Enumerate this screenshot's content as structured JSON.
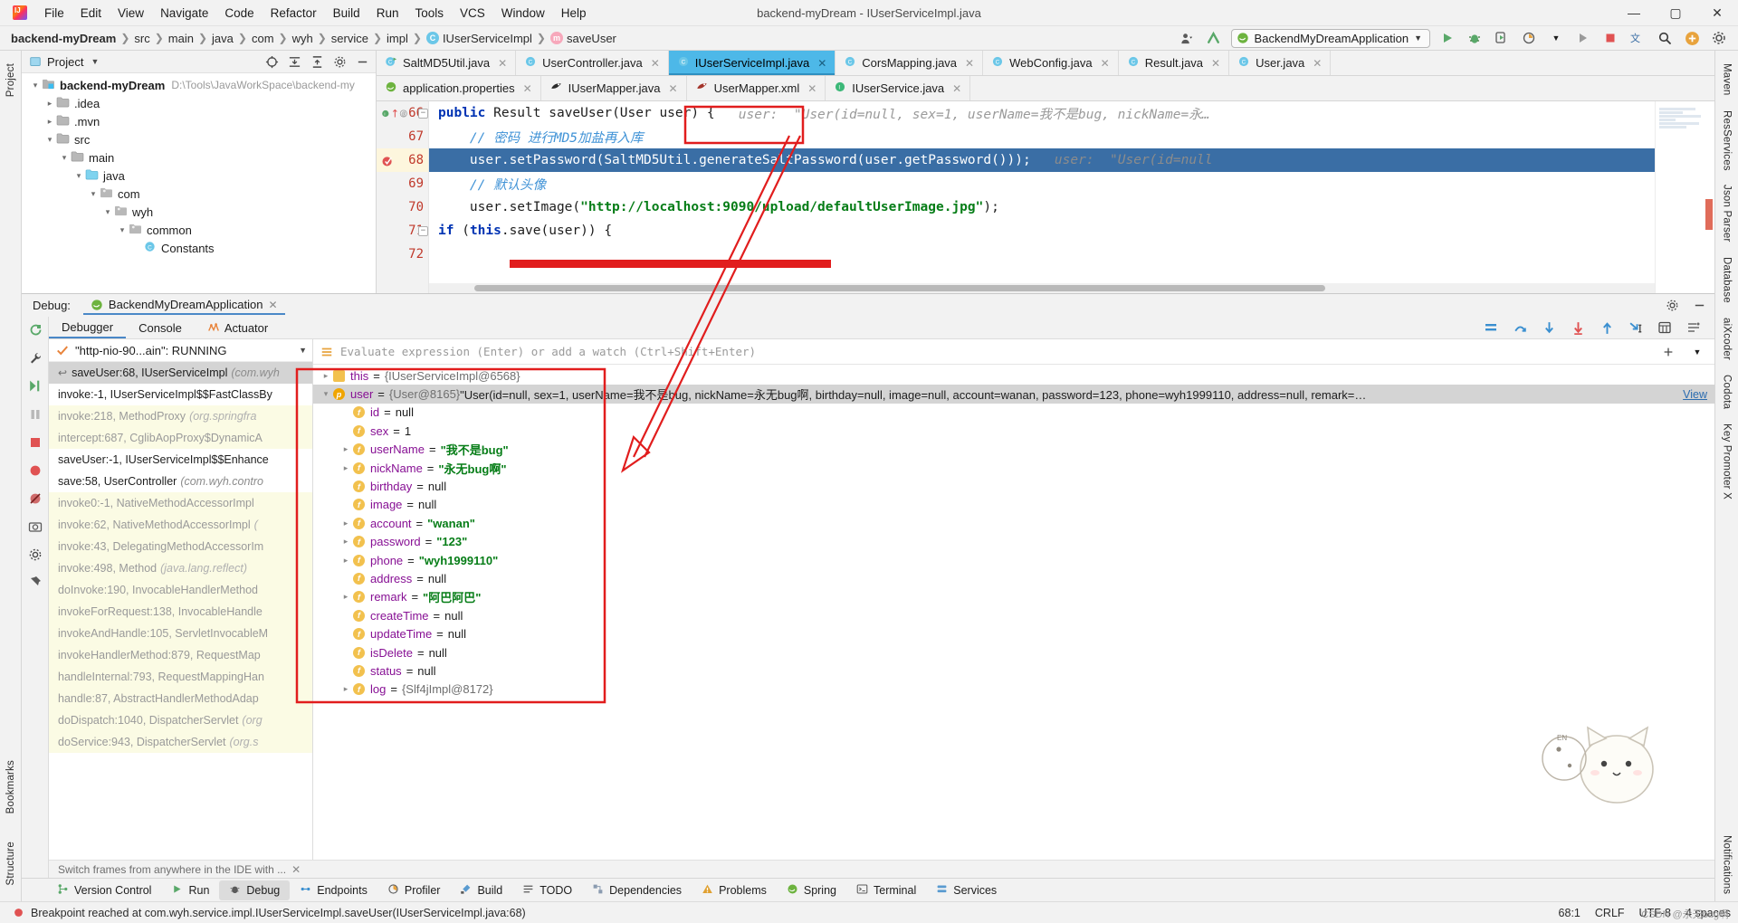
{
  "window": {
    "title": "backend-myDream - IUserServiceImpl.java",
    "minimize": "—",
    "maximize": "▢",
    "close": "✕"
  },
  "menu": [
    "File",
    "Edit",
    "View",
    "Navigate",
    "Code",
    "Refactor",
    "Build",
    "Run",
    "Tools",
    "VCS",
    "Window",
    "Help"
  ],
  "breadcrumb": {
    "project": "backend-myDream",
    "items": [
      "src",
      "main",
      "java",
      "com",
      "wyh",
      "service",
      "impl"
    ],
    "class": "IUserServiceImpl",
    "method": "saveUser"
  },
  "toolbar": {
    "run_config": "BackendMyDreamApplication",
    "run_label": "Run",
    "debug_label": "Debug",
    "stop_label": "Stop",
    "search_label": "Search Everywhere",
    "settings_label": "Settings"
  },
  "project_pane": {
    "title": "Project",
    "tree": [
      {
        "depth": 0,
        "arrow": "v",
        "icon": "module",
        "label": "backend-myDream",
        "bold": true,
        "path": "D:\\Tools\\JavaWorkSpace\\backend-my"
      },
      {
        "depth": 1,
        "arrow": ">",
        "icon": "folder",
        "label": ".idea",
        "bold": false,
        "path": ""
      },
      {
        "depth": 1,
        "arrow": ">",
        "icon": "folder",
        "label": ".mvn",
        "bold": false,
        "path": ""
      },
      {
        "depth": 1,
        "arrow": "v",
        "icon": "folder",
        "label": "src",
        "bold": false,
        "path": ""
      },
      {
        "depth": 2,
        "arrow": "v",
        "icon": "folder",
        "label": "main",
        "bold": false,
        "path": ""
      },
      {
        "depth": 3,
        "arrow": "v",
        "icon": "source",
        "label": "java",
        "bold": false,
        "path": ""
      },
      {
        "depth": 4,
        "arrow": "v",
        "icon": "package",
        "label": "com",
        "bold": false,
        "path": ""
      },
      {
        "depth": 5,
        "arrow": "v",
        "icon": "package",
        "label": "wyh",
        "bold": false,
        "path": ""
      },
      {
        "depth": 6,
        "arrow": "v",
        "icon": "package",
        "label": "common",
        "bold": false,
        "path": ""
      },
      {
        "depth": 7,
        "arrow": "",
        "icon": "class",
        "label": "Constants",
        "bold": false,
        "path": ""
      }
    ]
  },
  "editor": {
    "tabs_row1": [
      {
        "label": "SaltMD5Util.java",
        "icon": "class-run",
        "active": false
      },
      {
        "label": "UserController.java",
        "icon": "class",
        "active": false
      },
      {
        "label": "IUserServiceImpl.java",
        "icon": "class",
        "active": true
      },
      {
        "label": "CorsMapping.java",
        "icon": "class",
        "active": false
      },
      {
        "label": "WebConfig.java",
        "icon": "class",
        "active": false
      },
      {
        "label": "Result.java",
        "icon": "class",
        "active": false
      },
      {
        "label": "User.java",
        "icon": "class",
        "active": false
      }
    ],
    "tabs_row2": [
      {
        "label": "application.properties",
        "icon": "spring",
        "active": false
      },
      {
        "label": "IUserMapper.java",
        "icon": "mybatis",
        "active": false
      },
      {
        "label": "UserMapper.xml",
        "icon": "mybatis-xml",
        "active": false
      },
      {
        "label": "IUserService.java",
        "icon": "interface",
        "active": false
      }
    ],
    "lines": [
      {
        "num": "66",
        "gutter_marks": "impl-arrow-at",
        "code": "public Result saveUser(User user) {",
        "hint": "user:  \"User(id=null, sex=1, userName=我不是bug, nickName=永…",
        "highlight": false
      },
      {
        "num": "67",
        "gutter_marks": "",
        "code": "    // 密码 进行MD5加盐再入库",
        "hint": "",
        "highlight": false
      },
      {
        "num": "68",
        "gutter_marks": "breakpoint",
        "code": "    user.setPassword(SaltMD5Util.generateSaltPassword(user.getPassword()));",
        "hint": "user:  \"User(id=null",
        "highlight": true
      },
      {
        "num": "69",
        "gutter_marks": "",
        "code": "    // 默认头像",
        "hint": "",
        "highlight": false
      },
      {
        "num": "70",
        "gutter_marks": "",
        "code": "    user.setImage(\"http://localhost:9090/upload/defaultUserImage.jpg\");",
        "hint": "",
        "highlight": false
      },
      {
        "num": "71",
        "gutter_marks": "",
        "code": "    if (this.save(user)) {",
        "hint": "",
        "highlight": false
      },
      {
        "num": "72",
        "gutter_marks": "",
        "code": "",
        "hint": "",
        "highlight": false
      }
    ]
  },
  "debug": {
    "label": "Debug:",
    "session": "BackendMyDreamApplication",
    "tabs": [
      {
        "label": "Debugger",
        "active": true,
        "icon": ""
      },
      {
        "label": "Console",
        "active": false,
        "icon": ""
      },
      {
        "label": "Actuator",
        "active": false,
        "icon": "actuator-icon"
      }
    ],
    "thread": "\"http-nio-90...ain\": RUNNING",
    "frames": [
      {
        "text": "saveUser:68, IUserServiceImpl",
        "pkg": "(com.wyh",
        "lib": false,
        "selected": true,
        "ret": true
      },
      {
        "text": "invoke:-1, IUserServiceImpl$$FastClassBy",
        "pkg": "",
        "lib": false,
        "selected": false,
        "ret": false
      },
      {
        "text": "invoke:218, MethodProxy",
        "pkg": "(org.springfra",
        "lib": true,
        "selected": false,
        "ret": false
      },
      {
        "text": "intercept:687, CglibAopProxy$DynamicA",
        "pkg": "",
        "lib": true,
        "selected": false,
        "ret": false
      },
      {
        "text": "saveUser:-1, IUserServiceImpl$$Enhance",
        "pkg": "",
        "lib": false,
        "selected": false,
        "ret": false
      },
      {
        "text": "save:58, UserController",
        "pkg": "(com.wyh.contro",
        "lib": false,
        "selected": false,
        "ret": false
      },
      {
        "text": "invoke0:-1, NativeMethodAccessorImpl",
        "pkg": "",
        "lib": true,
        "selected": false,
        "ret": false
      },
      {
        "text": "invoke:62, NativeMethodAccessorImpl",
        "pkg": "(",
        "lib": true,
        "selected": false,
        "ret": false
      },
      {
        "text": "invoke:43, DelegatingMethodAccessorIm",
        "pkg": "",
        "lib": true,
        "selected": false,
        "ret": false
      },
      {
        "text": "invoke:498, Method",
        "pkg": "(java.lang.reflect)",
        "lib": true,
        "selected": false,
        "ret": false
      },
      {
        "text": "doInvoke:190, InvocableHandlerMethod",
        "pkg": "",
        "lib": true,
        "selected": false,
        "ret": false
      },
      {
        "text": "invokeForRequest:138, InvocableHandle",
        "pkg": "",
        "lib": true,
        "selected": false,
        "ret": false
      },
      {
        "text": "invokeAndHandle:105, ServletInvocableM",
        "pkg": "",
        "lib": true,
        "selected": false,
        "ret": false
      },
      {
        "text": "invokeHandlerMethod:879, RequestMap",
        "pkg": "",
        "lib": true,
        "selected": false,
        "ret": false
      },
      {
        "text": "handleInternal:793, RequestMappingHan",
        "pkg": "",
        "lib": true,
        "selected": false,
        "ret": false
      },
      {
        "text": "handle:87, AbstractHandlerMethodAdap",
        "pkg": "",
        "lib": true,
        "selected": false,
        "ret": false
      },
      {
        "text": "doDispatch:1040, DispatcherServlet",
        "pkg": "(org",
        "lib": true,
        "selected": false,
        "ret": false
      },
      {
        "text": "doService:943, DispatcherServlet",
        "pkg": "(org.s",
        "lib": true,
        "selected": false,
        "ret": false
      }
    ],
    "watch_placeholder": "Evaluate expression (Enter) or add a watch (Ctrl+Shift+Enter)",
    "variables": [
      {
        "indent": 0,
        "exp": ">",
        "chip": "t",
        "name": "this",
        "op": "=",
        "value": "{IUserServiceImpl@6568}",
        "kind": "obj",
        "selected": false
      },
      {
        "indent": 0,
        "exp": "v",
        "chip": "p",
        "name": "user",
        "op": "=",
        "value": "{User@8165}",
        "extra": "\"User(id=null, sex=1, userName=我不是bug, nickName=永无bug啊, birthday=null, image=null, account=wanan, password=123, phone=wyh1999110, address=null, remark=…",
        "kind": "obj",
        "selected": true
      },
      {
        "indent": 1,
        "exp": "",
        "chip": "f",
        "name": "id",
        "op": "=",
        "value": "null",
        "kind": "null",
        "selected": false
      },
      {
        "indent": 1,
        "exp": "",
        "chip": "f",
        "name": "sex",
        "op": "=",
        "value": "1",
        "kind": "num",
        "selected": false
      },
      {
        "indent": 1,
        "exp": ">",
        "chip": "f",
        "name": "userName",
        "op": "=",
        "value": "\"我不是bug\"",
        "kind": "str",
        "selected": false
      },
      {
        "indent": 1,
        "exp": ">",
        "chip": "f",
        "name": "nickName",
        "op": "=",
        "value": "\"永无bug啊\"",
        "kind": "str",
        "selected": false
      },
      {
        "indent": 1,
        "exp": "",
        "chip": "f",
        "name": "birthday",
        "op": "=",
        "value": "null",
        "kind": "null",
        "selected": false
      },
      {
        "indent": 1,
        "exp": "",
        "chip": "f",
        "name": "image",
        "op": "=",
        "value": "null",
        "kind": "null",
        "selected": false
      },
      {
        "indent": 1,
        "exp": ">",
        "chip": "f",
        "name": "account",
        "op": "=",
        "value": "\"wanan\"",
        "kind": "str",
        "selected": false
      },
      {
        "indent": 1,
        "exp": ">",
        "chip": "f",
        "name": "password",
        "op": "=",
        "value": "\"123\"",
        "kind": "str",
        "selected": false
      },
      {
        "indent": 1,
        "exp": ">",
        "chip": "f",
        "name": "phone",
        "op": "=",
        "value": "\"wyh1999110\"",
        "kind": "str",
        "selected": false
      },
      {
        "indent": 1,
        "exp": "",
        "chip": "f",
        "name": "address",
        "op": "=",
        "value": "null",
        "kind": "null",
        "selected": false
      },
      {
        "indent": 1,
        "exp": ">",
        "chip": "f",
        "name": "remark",
        "op": "=",
        "value": "\"阿巴阿巴\"",
        "kind": "str",
        "selected": false
      },
      {
        "indent": 1,
        "exp": "",
        "chip": "f",
        "name": "createTime",
        "op": "=",
        "value": "null",
        "kind": "null",
        "selected": false
      },
      {
        "indent": 1,
        "exp": "",
        "chip": "f",
        "name": "updateTime",
        "op": "=",
        "value": "null",
        "kind": "null",
        "selected": false
      },
      {
        "indent": 1,
        "exp": "",
        "chip": "f",
        "name": "isDelete",
        "op": "=",
        "value": "null",
        "kind": "null",
        "selected": false
      },
      {
        "indent": 1,
        "exp": "",
        "chip": "f",
        "name": "status",
        "op": "=",
        "value": "null",
        "kind": "null",
        "selected": false
      },
      {
        "indent": 1,
        "exp": ">",
        "chip": "f",
        "name": "log",
        "op": "=",
        "value": "{Slf4jImpl@8172}",
        "kind": "obj",
        "selected": false
      }
    ],
    "view_link": "View",
    "hint_bar": "Switch frames from anywhere in the IDE with ..."
  },
  "bottom_tabs": [
    {
      "label": "Version Control",
      "icon": "branch-icon",
      "active": false
    },
    {
      "label": "Run",
      "icon": "run-icon",
      "active": false
    },
    {
      "label": "Debug",
      "icon": "debug-icon",
      "active": true
    },
    {
      "label": "Endpoints",
      "icon": "endpoints-icon",
      "active": false
    },
    {
      "label": "Profiler",
      "icon": "profiler-icon",
      "active": false
    },
    {
      "label": "Build",
      "icon": "build-icon",
      "active": false
    },
    {
      "label": "TODO",
      "icon": "todo-icon",
      "active": false
    },
    {
      "label": "Dependencies",
      "icon": "dependencies-icon",
      "active": false
    },
    {
      "label": "Problems",
      "icon": "problems-icon",
      "active": false
    },
    {
      "label": "Spring",
      "icon": "spring-icon",
      "active": false
    },
    {
      "label": "Terminal",
      "icon": "terminal-icon",
      "active": false
    },
    {
      "label": "Services",
      "icon": "services-icon",
      "active": false
    }
  ],
  "left_strip": [
    {
      "label": "Project",
      "pos": "top"
    },
    {
      "label": "Bookmarks",
      "pos": "bottom"
    },
    {
      "label": "Structure",
      "pos": "bottom"
    }
  ],
  "right_strip": [
    {
      "label": "Maven"
    },
    {
      "label": "ResServices"
    },
    {
      "label": "Json Parser"
    },
    {
      "label": "Database"
    },
    {
      "label": "aiXcoder"
    },
    {
      "label": "Codota"
    },
    {
      "label": "Key Promoter X"
    },
    {
      "label": "Notifications"
    }
  ],
  "statusbar": {
    "message": "Breakpoint reached at com.wyh.service.impl.IUserServiceImpl.saveUser(IUserServiceImpl.java:68)",
    "caret": "68:1",
    "line_sep": "CRLF",
    "encoding": "UTF-8",
    "indent": "4 spaces"
  },
  "colors": {
    "accent": "#4db8e8",
    "annotation_red": "#e11d1d",
    "string_green": "#067d17",
    "keyword_blue": "#0033b3",
    "comment_blue": "#3f92d6",
    "highlight_blue": "#3a6ea5",
    "lib_frame_yellow": "#fbfbe4"
  }
}
